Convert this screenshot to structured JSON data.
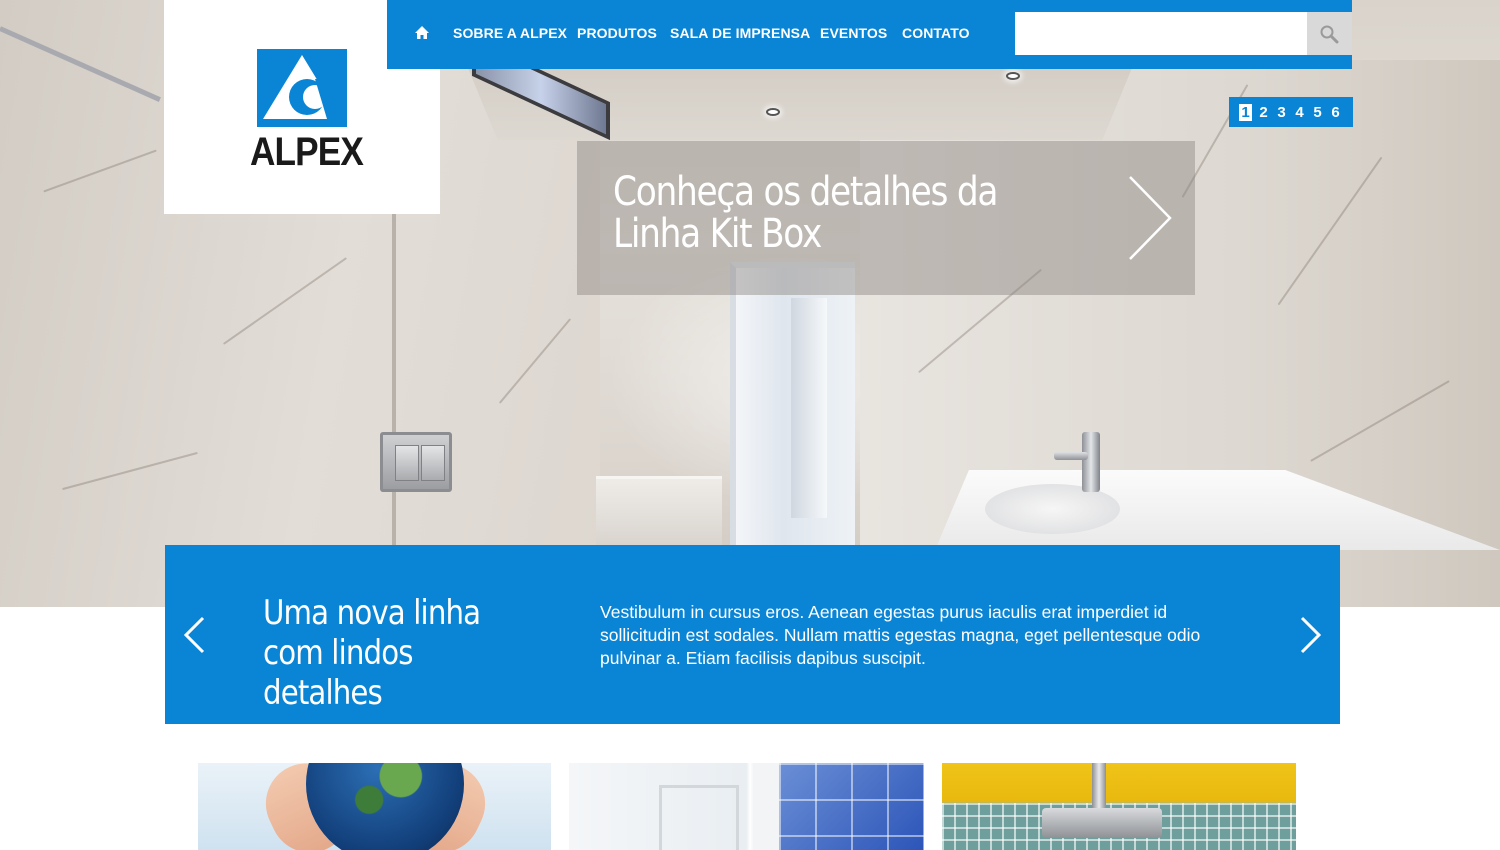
{
  "brand": {
    "logo_text": "ALPEX",
    "accent_color": "#0a85d6"
  },
  "nav": {
    "home_icon": "home-icon",
    "items": [
      {
        "label": "SOBRE A ALPEX"
      },
      {
        "label": "PRODUTOS"
      },
      {
        "label": "SALA DE IMPRENSA"
      },
      {
        "label": "EVENTOS"
      },
      {
        "label": "CONTATO"
      }
    ]
  },
  "search": {
    "value": "",
    "placeholder": "",
    "button_icon": "search-icon"
  },
  "slider": {
    "pages": [
      "1",
      "2",
      "3",
      "4",
      "5",
      "6"
    ],
    "active_page": "1",
    "caption": "Conheça os detalhes da Linha Kit Box",
    "next_icon": "chevron-right-icon"
  },
  "feature": {
    "title": "Uma nova linha com lindos detalhes",
    "body": "Vestibulum in cursus eros. Aenean egestas purus iaculis erat imperdiet id sollicitudin est sodales. Nullam mattis egestas magna, eget pellentesque odio pulvinar a. Etiam facilisis dapibus suscipit.",
    "prev_icon": "chevron-left-icon",
    "next_icon": "chevron-right-icon"
  },
  "thumbnails": [
    {
      "subject": "globe-in-hands"
    },
    {
      "subject": "blue-tiled-shower"
    },
    {
      "subject": "shower-head-yellow-wall"
    }
  ]
}
